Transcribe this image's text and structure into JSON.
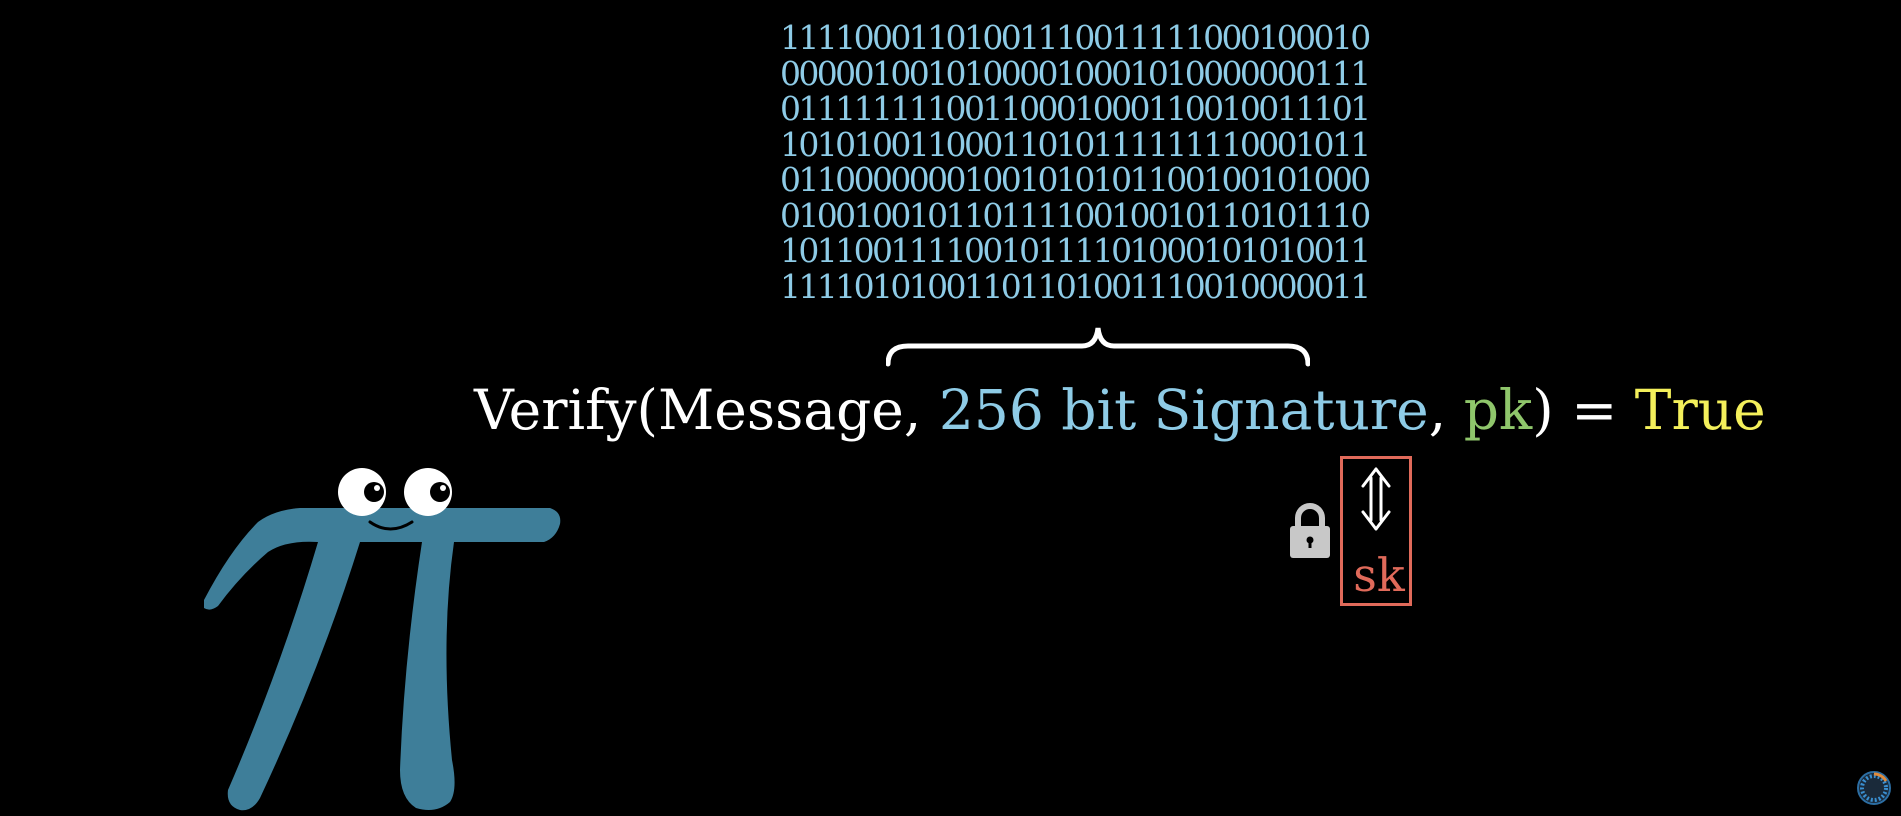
{
  "binary_rows": [
    "11110001101001110011111000100010",
    "00000100101000010001010000000111",
    "01111111100110001000110010011101",
    "10101001100011010111111110001011",
    "01100000001001010101100100101000",
    "01001001011011110010010110101110",
    "10110011110010111101000101010011",
    "11110101001101101001110010000011"
  ],
  "equation": {
    "func": "Verify(Message, ",
    "signature": "256 bit Signature",
    "comma": ", ",
    "pk": "pk",
    "close": ")",
    "equals": " = ",
    "result": "True"
  },
  "secret_key": {
    "label": "sk",
    "arrow": "⇕"
  },
  "icons": [
    "lock-icon",
    "pi-creature-mascot",
    "loading-spinner-icon"
  ],
  "colors": {
    "background": "#000000",
    "binary": "#8ecbe6",
    "signature": "#8ecbe6",
    "pk": "#8fc66b",
    "true": "#f4f05b",
    "sk": "#e06a5a",
    "pi": "#3e7e99"
  }
}
